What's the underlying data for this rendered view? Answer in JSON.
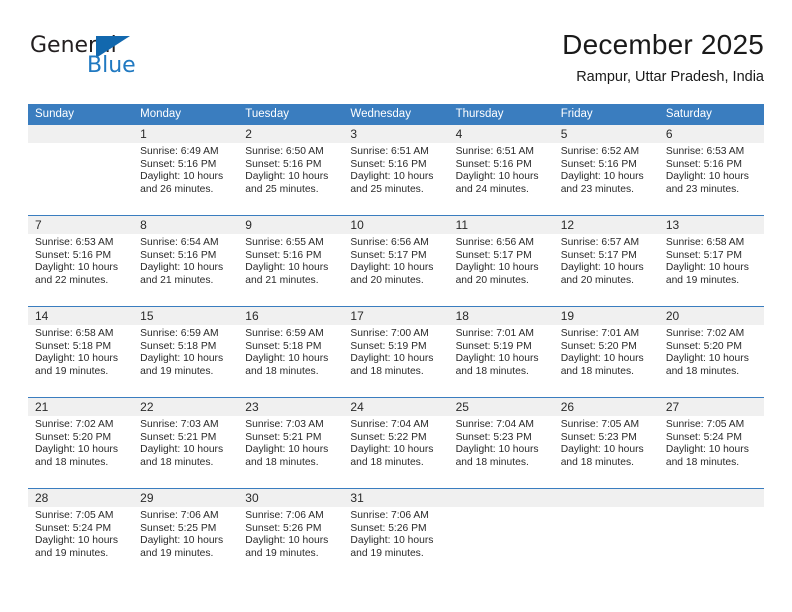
{
  "logo": {
    "word_top": "General",
    "word_bottom": "Blue",
    "triangle": "triangle-icon",
    "colors": {
      "dark": "#231f20",
      "blue": "#2079c1",
      "triangle": "#1268ae"
    }
  },
  "header": {
    "title": "December 2025",
    "subtitle": "Rampur, Uttar Pradesh, India"
  },
  "theme": {
    "header_blue": "#3a7dbf",
    "daynum_band": "#f0f0f0",
    "text": "#2a2a2a"
  },
  "calendar": {
    "weekdays": [
      "Sunday",
      "Monday",
      "Tuesday",
      "Wednesday",
      "Thursday",
      "Friday",
      "Saturday"
    ],
    "weeks": [
      [
        {
          "day": "",
          "sunrise": "",
          "sunset": "",
          "daylight_line1": "",
          "daylight_line2": ""
        },
        {
          "day": "1",
          "sunrise": "Sunrise: 6:49 AM",
          "sunset": "Sunset: 5:16 PM",
          "daylight_line1": "Daylight: 10 hours",
          "daylight_line2": "and 26 minutes."
        },
        {
          "day": "2",
          "sunrise": "Sunrise: 6:50 AM",
          "sunset": "Sunset: 5:16 PM",
          "daylight_line1": "Daylight: 10 hours",
          "daylight_line2": "and 25 minutes."
        },
        {
          "day": "3",
          "sunrise": "Sunrise: 6:51 AM",
          "sunset": "Sunset: 5:16 PM",
          "daylight_line1": "Daylight: 10 hours",
          "daylight_line2": "and 25 minutes."
        },
        {
          "day": "4",
          "sunrise": "Sunrise: 6:51 AM",
          "sunset": "Sunset: 5:16 PM",
          "daylight_line1": "Daylight: 10 hours",
          "daylight_line2": "and 24 minutes."
        },
        {
          "day": "5",
          "sunrise": "Sunrise: 6:52 AM",
          "sunset": "Sunset: 5:16 PM",
          "daylight_line1": "Daylight: 10 hours",
          "daylight_line2": "and 23 minutes."
        },
        {
          "day": "6",
          "sunrise": "Sunrise: 6:53 AM",
          "sunset": "Sunset: 5:16 PM",
          "daylight_line1": "Daylight: 10 hours",
          "daylight_line2": "and 23 minutes."
        }
      ],
      [
        {
          "day": "7",
          "sunrise": "Sunrise: 6:53 AM",
          "sunset": "Sunset: 5:16 PM",
          "daylight_line1": "Daylight: 10 hours",
          "daylight_line2": "and 22 minutes."
        },
        {
          "day": "8",
          "sunrise": "Sunrise: 6:54 AM",
          "sunset": "Sunset: 5:16 PM",
          "daylight_line1": "Daylight: 10 hours",
          "daylight_line2": "and 21 minutes."
        },
        {
          "day": "9",
          "sunrise": "Sunrise: 6:55 AM",
          "sunset": "Sunset: 5:16 PM",
          "daylight_line1": "Daylight: 10 hours",
          "daylight_line2": "and 21 minutes."
        },
        {
          "day": "10",
          "sunrise": "Sunrise: 6:56 AM",
          "sunset": "Sunset: 5:17 PM",
          "daylight_line1": "Daylight: 10 hours",
          "daylight_line2": "and 20 minutes."
        },
        {
          "day": "11",
          "sunrise": "Sunrise: 6:56 AM",
          "sunset": "Sunset: 5:17 PM",
          "daylight_line1": "Daylight: 10 hours",
          "daylight_line2": "and 20 minutes."
        },
        {
          "day": "12",
          "sunrise": "Sunrise: 6:57 AM",
          "sunset": "Sunset: 5:17 PM",
          "daylight_line1": "Daylight: 10 hours",
          "daylight_line2": "and 20 minutes."
        },
        {
          "day": "13",
          "sunrise": "Sunrise: 6:58 AM",
          "sunset": "Sunset: 5:17 PM",
          "daylight_line1": "Daylight: 10 hours",
          "daylight_line2": "and 19 minutes."
        }
      ],
      [
        {
          "day": "14",
          "sunrise": "Sunrise: 6:58 AM",
          "sunset": "Sunset: 5:18 PM",
          "daylight_line1": "Daylight: 10 hours",
          "daylight_line2": "and 19 minutes."
        },
        {
          "day": "15",
          "sunrise": "Sunrise: 6:59 AM",
          "sunset": "Sunset: 5:18 PM",
          "daylight_line1": "Daylight: 10 hours",
          "daylight_line2": "and 19 minutes."
        },
        {
          "day": "16",
          "sunrise": "Sunrise: 6:59 AM",
          "sunset": "Sunset: 5:18 PM",
          "daylight_line1": "Daylight: 10 hours",
          "daylight_line2": "and 18 minutes."
        },
        {
          "day": "17",
          "sunrise": "Sunrise: 7:00 AM",
          "sunset": "Sunset: 5:19 PM",
          "daylight_line1": "Daylight: 10 hours",
          "daylight_line2": "and 18 minutes."
        },
        {
          "day": "18",
          "sunrise": "Sunrise: 7:01 AM",
          "sunset": "Sunset: 5:19 PM",
          "daylight_line1": "Daylight: 10 hours",
          "daylight_line2": "and 18 minutes."
        },
        {
          "day": "19",
          "sunrise": "Sunrise: 7:01 AM",
          "sunset": "Sunset: 5:20 PM",
          "daylight_line1": "Daylight: 10 hours",
          "daylight_line2": "and 18 minutes."
        },
        {
          "day": "20",
          "sunrise": "Sunrise: 7:02 AM",
          "sunset": "Sunset: 5:20 PM",
          "daylight_line1": "Daylight: 10 hours",
          "daylight_line2": "and 18 minutes."
        }
      ],
      [
        {
          "day": "21",
          "sunrise": "Sunrise: 7:02 AM",
          "sunset": "Sunset: 5:20 PM",
          "daylight_line1": "Daylight: 10 hours",
          "daylight_line2": "and 18 minutes."
        },
        {
          "day": "22",
          "sunrise": "Sunrise: 7:03 AM",
          "sunset": "Sunset: 5:21 PM",
          "daylight_line1": "Daylight: 10 hours",
          "daylight_line2": "and 18 minutes."
        },
        {
          "day": "23",
          "sunrise": "Sunrise: 7:03 AM",
          "sunset": "Sunset: 5:21 PM",
          "daylight_line1": "Daylight: 10 hours",
          "daylight_line2": "and 18 minutes."
        },
        {
          "day": "24",
          "sunrise": "Sunrise: 7:04 AM",
          "sunset": "Sunset: 5:22 PM",
          "daylight_line1": "Daylight: 10 hours",
          "daylight_line2": "and 18 minutes."
        },
        {
          "day": "25",
          "sunrise": "Sunrise: 7:04 AM",
          "sunset": "Sunset: 5:23 PM",
          "daylight_line1": "Daylight: 10 hours",
          "daylight_line2": "and 18 minutes."
        },
        {
          "day": "26",
          "sunrise": "Sunrise: 7:05 AM",
          "sunset": "Sunset: 5:23 PM",
          "daylight_line1": "Daylight: 10 hours",
          "daylight_line2": "and 18 minutes."
        },
        {
          "day": "27",
          "sunrise": "Sunrise: 7:05 AM",
          "sunset": "Sunset: 5:24 PM",
          "daylight_line1": "Daylight: 10 hours",
          "daylight_line2": "and 18 minutes."
        }
      ],
      [
        {
          "day": "28",
          "sunrise": "Sunrise: 7:05 AM",
          "sunset": "Sunset: 5:24 PM",
          "daylight_line1": "Daylight: 10 hours",
          "daylight_line2": "and 19 minutes."
        },
        {
          "day": "29",
          "sunrise": "Sunrise: 7:06 AM",
          "sunset": "Sunset: 5:25 PM",
          "daylight_line1": "Daylight: 10 hours",
          "daylight_line2": "and 19 minutes."
        },
        {
          "day": "30",
          "sunrise": "Sunrise: 7:06 AM",
          "sunset": "Sunset: 5:26 PM",
          "daylight_line1": "Daylight: 10 hours",
          "daylight_line2": "and 19 minutes."
        },
        {
          "day": "31",
          "sunrise": "Sunrise: 7:06 AM",
          "sunset": "Sunset: 5:26 PM",
          "daylight_line1": "Daylight: 10 hours",
          "daylight_line2": "and 19 minutes."
        },
        {
          "day": "",
          "sunrise": "",
          "sunset": "",
          "daylight_line1": "",
          "daylight_line2": ""
        },
        {
          "day": "",
          "sunrise": "",
          "sunset": "",
          "daylight_line1": "",
          "daylight_line2": ""
        },
        {
          "day": "",
          "sunrise": "",
          "sunset": "",
          "daylight_line1": "",
          "daylight_line2": ""
        }
      ]
    ]
  }
}
